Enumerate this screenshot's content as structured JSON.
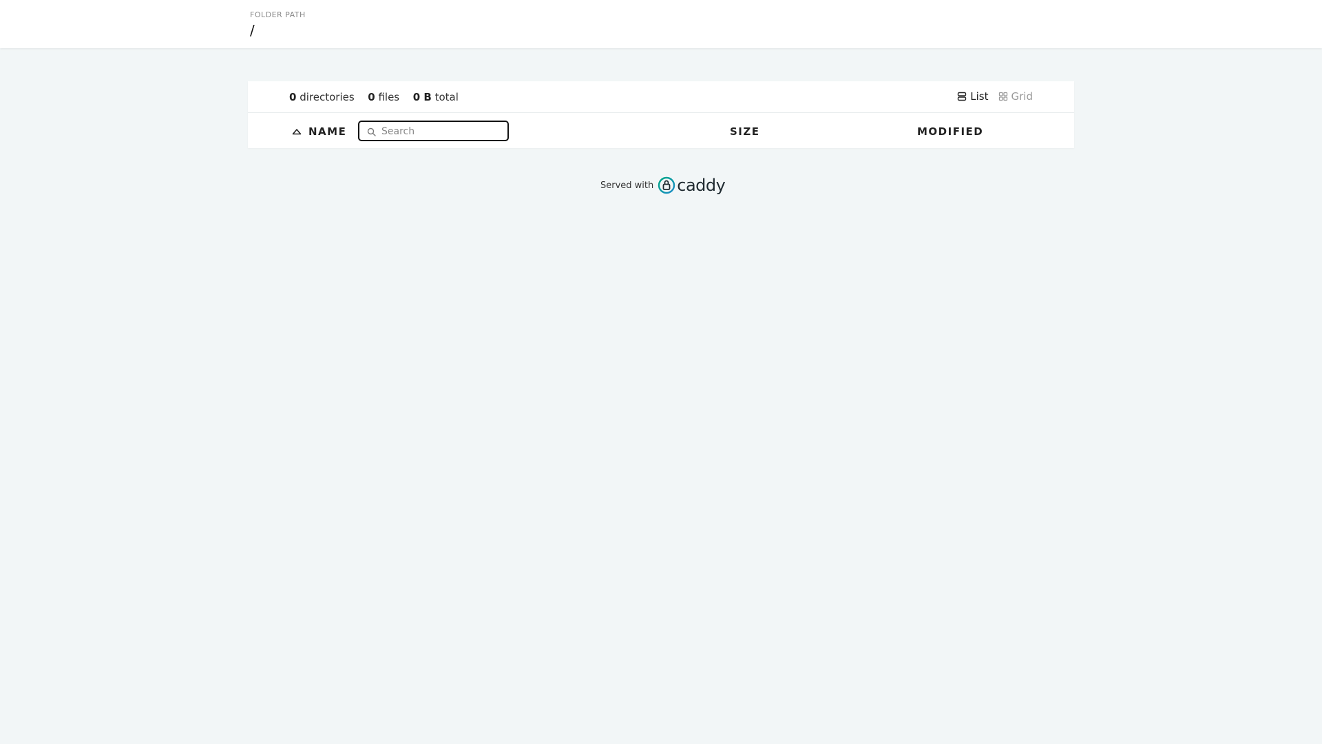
{
  "header": {
    "folder_label": "FOLDER PATH",
    "path": "/"
  },
  "summary": {
    "directories_count": "0",
    "directories_label": "directories",
    "files_count": "0",
    "files_label": "files",
    "total_size": "0 B",
    "total_label": "total"
  },
  "view": {
    "list_label": "List",
    "grid_label": "Grid",
    "active": "list"
  },
  "table": {
    "name_header": "NAME",
    "size_header": "SIZE",
    "modified_header": "MODIFIED",
    "search_placeholder": "Search",
    "search_value": ""
  },
  "footer": {
    "served_with": "Served with",
    "brand": "caddy",
    "brand_colors": [
      "#00a884",
      "#1a8bc9",
      "#1f2a30"
    ]
  },
  "icons": {
    "list": "list-icon",
    "grid": "grid-icon",
    "sort": "sort-ascending-icon",
    "search": "search-icon",
    "logo": "caddy-lock-icon"
  }
}
